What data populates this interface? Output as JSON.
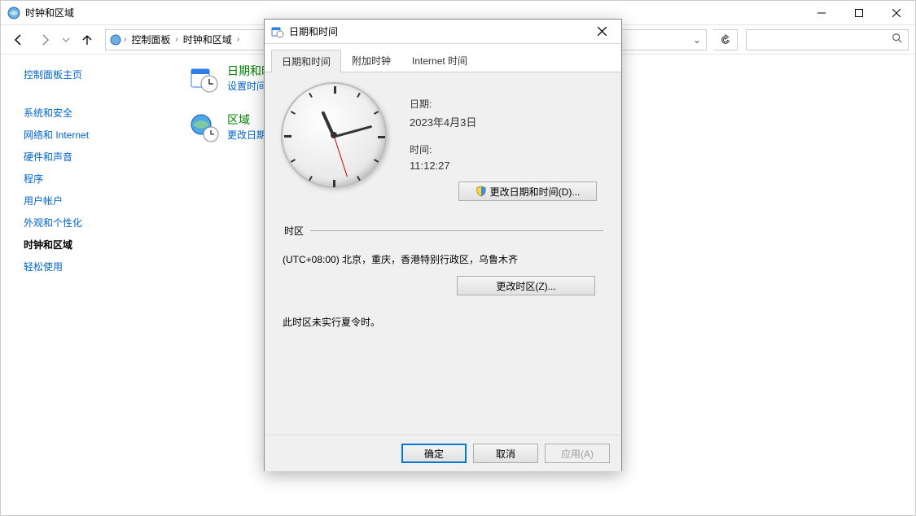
{
  "window": {
    "title": "时钟和区域"
  },
  "breadcrumbs": {
    "item0": "控制面板",
    "item1": "时钟和区域"
  },
  "search": {
    "placeholder": ""
  },
  "sidebar": {
    "home": "控制面板主页",
    "items": {
      "0": "系统和安全",
      "1": "网络和 Internet",
      "2": "硬件和声音",
      "3": "程序",
      "4": "用户帐户",
      "5": "外观和个性化",
      "6": "时钟和区域",
      "7": "轻松使用"
    }
  },
  "main": {
    "item0": {
      "title": "日期和时间",
      "sub": "设置时间和日期"
    },
    "item1": {
      "title": "区域",
      "sub": "更改日期、时间或数字格式"
    }
  },
  "dialog": {
    "title": "日期和时间",
    "tabs": {
      "0": "日期和时间",
      "1": "附加时钟",
      "2": "Internet 时间"
    },
    "date_label": "日期:",
    "date_value": "2023年4月3日",
    "time_label": "时间:",
    "time_value": "11:12:27",
    "change_dt_btn": "更改日期和时间(D)...",
    "tz_legend": "时区",
    "tz_value": "(UTC+08:00) 北京，重庆，香港特别行政区，乌鲁木齐",
    "change_tz_btn": "更改时区(Z)...",
    "dst_note": "此时区未实行夏令时。",
    "ok": "确定",
    "cancel": "取消",
    "apply": "应用(A)"
  },
  "clock": {
    "hour": 11,
    "minute": 12,
    "second": 27
  }
}
